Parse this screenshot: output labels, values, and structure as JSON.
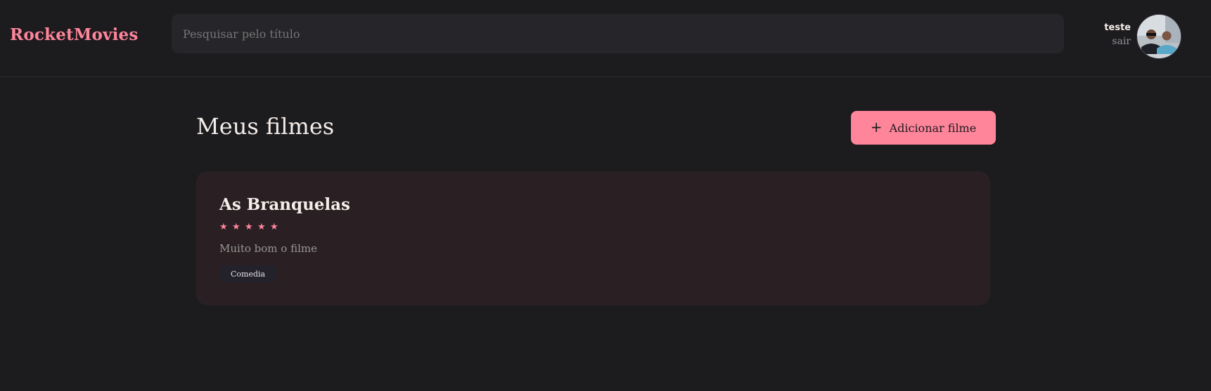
{
  "header": {
    "logo": "RocketMovies",
    "search_placeholder": "Pesquisar pelo título",
    "profile": {
      "name": "teste",
      "signout": "sair"
    }
  },
  "main": {
    "title": "Meus filmes",
    "add_button": {
      "icon": "plus-icon",
      "label": "Adicionar filme"
    },
    "movies": [
      {
        "title": "As Branquelas",
        "rating": 5,
        "rating_max": 5,
        "description": "Muito bom o filme",
        "tags": [
          "Comedia"
        ]
      }
    ]
  },
  "colors": {
    "background": "#1c1b1e",
    "accent": "#ff859b",
    "card": "#2a2024",
    "input": "#262529"
  }
}
